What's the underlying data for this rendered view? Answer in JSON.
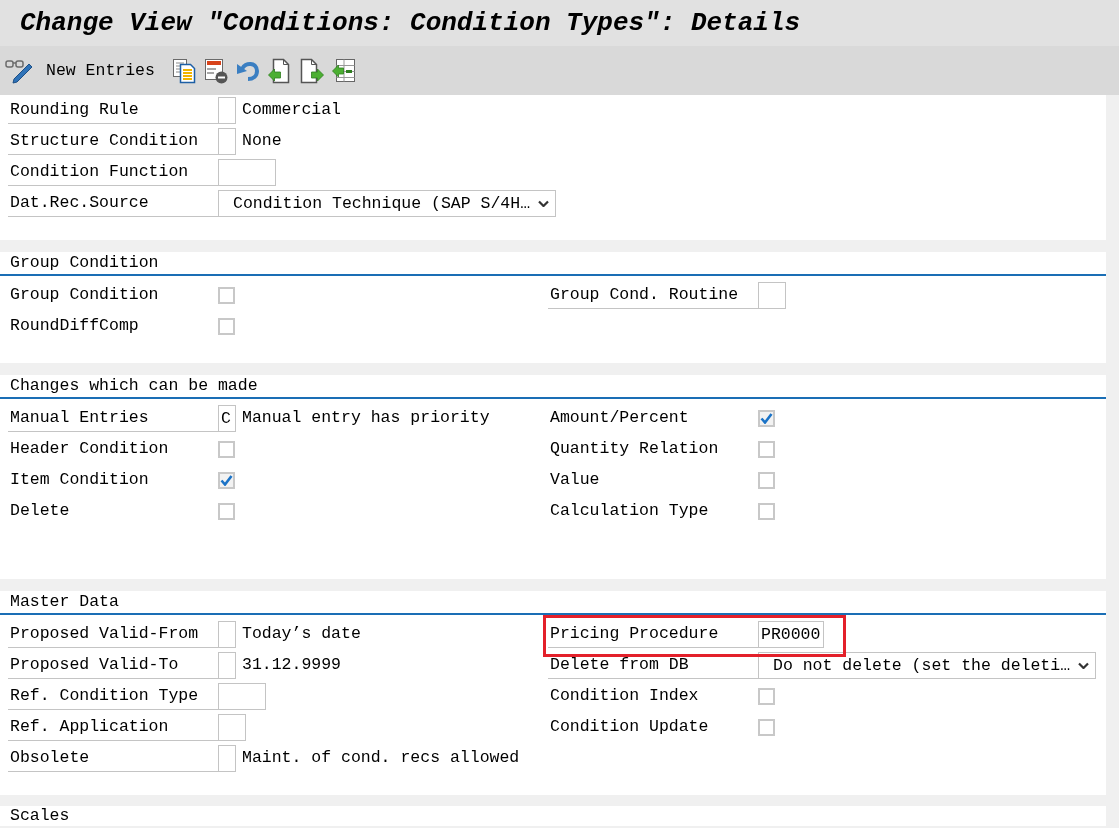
{
  "window": {
    "title": "Change View \"Conditions: Condition Types\": Details"
  },
  "toolbar": {
    "new_entries": "New Entries"
  },
  "sections": [
    {
      "left": [
        {
          "kind": "flag",
          "label": "Rounding Rule",
          "text": "Commercial"
        },
        {
          "kind": "flag",
          "label": "Structure Condition",
          "text": "None"
        },
        {
          "kind": "field",
          "label": "Condition Function"
        },
        {
          "kind": "dropdown",
          "label": "Dat.Rec.Source",
          "value": "Condition Technique (SAP S/4H…"
        }
      ]
    },
    {
      "title": "Group Condition",
      "left": [
        {
          "kind": "checkbox",
          "label": "Group Condition",
          "checked": false
        },
        {
          "kind": "checkbox",
          "label": "RoundDiffComp",
          "checked": false
        }
      ],
      "right": [
        {
          "kind": "field",
          "label": "Group Cond. Routine"
        }
      ]
    },
    {
      "title": "Changes which can be made",
      "left": [
        {
          "kind": "flag",
          "label": "Manual Entries",
          "value": "C",
          "text": "Manual entry has priority"
        },
        {
          "kind": "checkbox",
          "label": "Header Condition",
          "checked": false
        },
        {
          "kind": "checkbox",
          "label": "Item Condition",
          "checked": true
        },
        {
          "kind": "checkbox",
          "label": "Delete",
          "checked": false
        }
      ],
      "right": [
        {
          "kind": "checkbox",
          "label": "Amount/Percent",
          "checked": true
        },
        {
          "kind": "checkbox",
          "label": "Quantity Relation",
          "checked": false
        },
        {
          "kind": "checkbox",
          "label": "Value",
          "checked": false
        },
        {
          "kind": "checkbox",
          "label": "Calculation Type",
          "checked": false
        }
      ]
    },
    {
      "title": "Master Data",
      "left": [
        {
          "kind": "flag",
          "label": "Proposed Valid-From",
          "text": "Today’s date"
        },
        {
          "kind": "flag",
          "label": "Proposed Valid-To",
          "text": "31.12.9999"
        },
        {
          "kind": "field",
          "label": "Ref. Condition Type"
        },
        {
          "kind": "field",
          "label": "Ref. Application"
        },
        {
          "kind": "flag",
          "label": "Obsolete",
          "text": "Maint. of cond. recs allowed"
        }
      ],
      "right": [
        {
          "kind": "field",
          "label": "Pricing Procedure",
          "value": "PR0000",
          "highlighted": true
        },
        {
          "kind": "dropdown",
          "label": "Delete from DB",
          "value": "Do not delete (set the deleti…"
        },
        {
          "kind": "checkbox",
          "label": "Condition Index",
          "checked": false
        },
        {
          "kind": "checkbox",
          "label": "Condition Update",
          "checked": false
        }
      ]
    },
    {
      "title": "Scales"
    }
  ]
}
